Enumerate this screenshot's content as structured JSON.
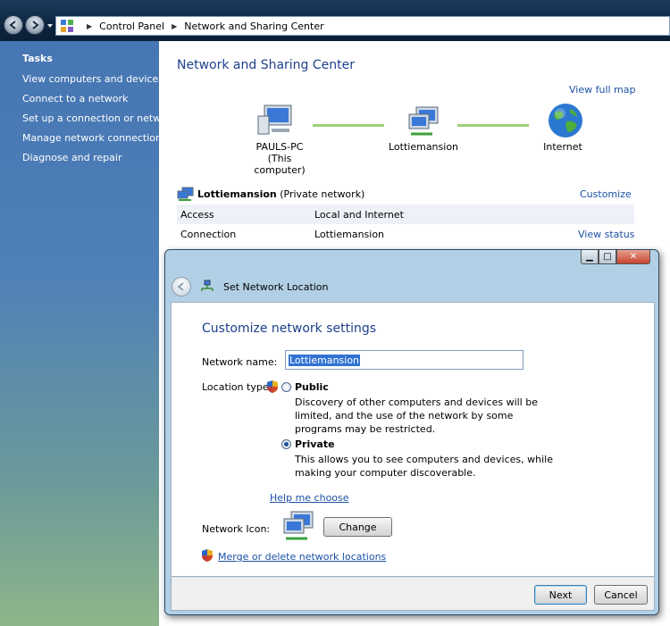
{
  "address": {
    "crumbs": [
      "Control Panel",
      "Network and Sharing Center"
    ]
  },
  "sidebar": {
    "header": "Tasks",
    "items": [
      "View computers and devices",
      "Connect to a network",
      "Set up a connection or network",
      "Manage network connections",
      "Diagnose and repair"
    ]
  },
  "main": {
    "title": "Network and Sharing Center",
    "view_full_map": "View full map",
    "map": {
      "computer_name": "PAULS-PC",
      "computer_sub": "(This computer)",
      "network_name": "Lottiemansion",
      "internet": "Internet"
    },
    "network": {
      "name": "Lottiemansion",
      "type": "(Private network)",
      "customize": "Customize",
      "rows": [
        {
          "key": "Access",
          "value": "Local and Internet"
        },
        {
          "key": "Connection",
          "value": "Lottiemansion",
          "action": "View status"
        }
      ]
    }
  },
  "dialog": {
    "title": "Set Network Location",
    "heading": "Customize network settings",
    "network_name_label": "Network name:",
    "network_name_value": "Lottiemansion",
    "location_type_label": "Location type:",
    "options": [
      {
        "label": "Public",
        "desc": "Discovery of other computers and devices will be limited, and the use of the network by some programs may be restricted.",
        "selected": false
      },
      {
        "label": "Private",
        "desc": "This allows you to see computers and devices, while making your computer discoverable.",
        "selected": true
      }
    ],
    "help_link": "Help me choose",
    "network_icon_label": "Network Icon:",
    "change_button": "Change",
    "merge_link": "Merge or delete network locations",
    "next_button": "Next",
    "cancel_button": "Cancel"
  }
}
